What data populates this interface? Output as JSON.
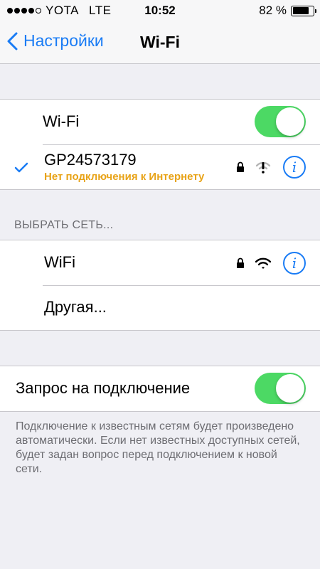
{
  "status_bar": {
    "carrier": "YOTA",
    "network": "LTE",
    "time": "10:52",
    "battery": "82 %",
    "battery_level": 0.82
  },
  "nav": {
    "back_label": "Настройки",
    "title": "Wi-Fi"
  },
  "wifi_group": {
    "wifi_label": "Wi-Fi",
    "wifi_enabled": true,
    "current_network": {
      "name": "GP24573179",
      "status": "Нет подключения к Интернету",
      "status_color": "#e8a317"
    }
  },
  "choose_network": {
    "header": "ВЫБРАТЬ СЕТЬ...",
    "networks": [
      {
        "name": "WiFi",
        "secured": true
      }
    ],
    "other_label": "Другая..."
  },
  "ask_join": {
    "label": "Запрос на подключение",
    "enabled": true,
    "description": "Подключение к известным сетям будет произведено автоматически. Если нет известных доступных сетей, будет задан вопрос перед подключением к новой сети."
  },
  "colors": {
    "accent": "#1a7cf5",
    "toggle_on": "#4cd964",
    "background": "#efeff4"
  }
}
